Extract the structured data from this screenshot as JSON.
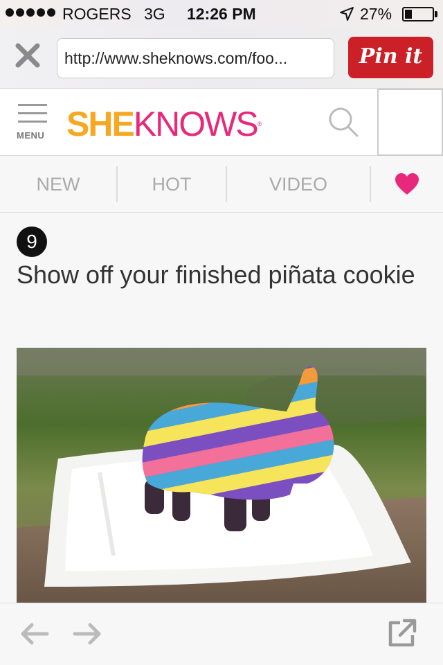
{
  "status_bar": {
    "carrier": "ROGERS",
    "network": "3G",
    "time": "12:26 PM",
    "battery_percent": "27%",
    "battery_level": 0.27
  },
  "browser": {
    "url": "http://www.sheknows.com/foo...",
    "pin_label": "Pin it",
    "pin_color": "#cb2027"
  },
  "site": {
    "menu_label": "MENU",
    "logo_she": "SHE",
    "logo_knows": "KNOWS",
    "logo_mark": "®",
    "brand_orange": "#f7a823",
    "brand_pink": "#e8287a"
  },
  "nav": {
    "tabs": [
      {
        "label": "NEW"
      },
      {
        "label": "HOT"
      },
      {
        "label": "VIDEO"
      },
      {
        "icon": "heart-icon"
      }
    ]
  },
  "step": {
    "number": "9",
    "title": "Show off your finished piñata cookie"
  },
  "toolbar": {
    "icons": [
      "back-arrow-icon",
      "forward-arrow-icon",
      "share-icon"
    ]
  }
}
